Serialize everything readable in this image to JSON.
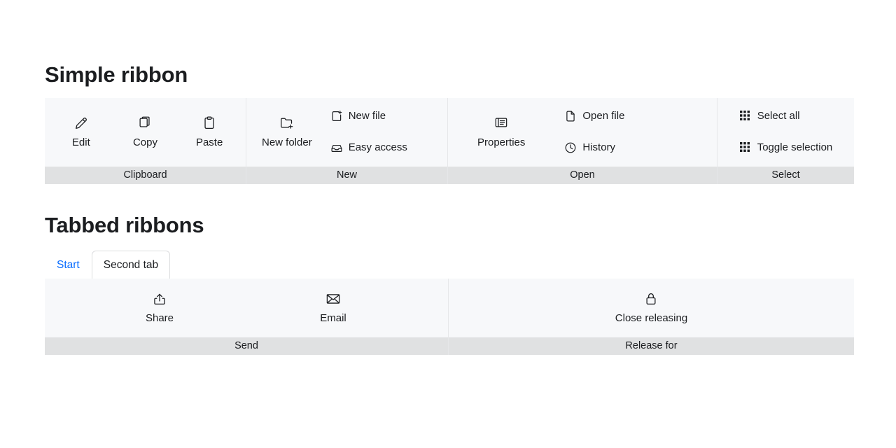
{
  "sections": {
    "simple": {
      "title": "Simple ribbon"
    },
    "tabbed": {
      "title": "Tabbed ribbons"
    }
  },
  "colors": {
    "ribbon_bg": "#f7f8fa",
    "footer_bg": "#e0e1e2",
    "separator": "#e6e7e9",
    "text": "#1b1d20",
    "active_tab_text": "#0a6dff",
    "tab_border": "#dcdddf"
  },
  "simple_ribbon": {
    "groups": [
      {
        "footer": "Clipboard",
        "large_items": [
          {
            "label": "Edit",
            "icon": "pencil-icon"
          },
          {
            "label": "Copy",
            "icon": "copy-icon"
          },
          {
            "label": "Paste",
            "icon": "clipboard-icon"
          }
        ],
        "small_items": []
      },
      {
        "footer": "New",
        "large_items": [
          {
            "label": "New folder",
            "icon": "folder-add-icon"
          }
        ],
        "small_items": [
          {
            "label": "New file",
            "icon": "file-add-icon"
          },
          {
            "label": "Easy access",
            "icon": "inbox-icon"
          }
        ]
      },
      {
        "footer": "Open",
        "large_items": [
          {
            "label": "Properties",
            "icon": "list-details-icon"
          }
        ],
        "small_items": [
          {
            "label": "Open file",
            "icon": "document-icon"
          },
          {
            "label": "History",
            "icon": "clock-icon"
          }
        ]
      },
      {
        "footer": "Select",
        "large_items": [],
        "small_items": [
          {
            "label": "Select all",
            "icon": "grid-dots-icon"
          },
          {
            "label": "Toggle selection",
            "icon": "grid-dots-icon"
          }
        ]
      }
    ]
  },
  "tabbed_ribbon": {
    "tabs": [
      {
        "label": "Start",
        "state": "active"
      },
      {
        "label": "Second tab",
        "state": "inactive"
      }
    ],
    "groups": [
      {
        "footer": "Send",
        "large_items": [
          {
            "label": "Share",
            "icon": "share-icon"
          },
          {
            "label": "Email",
            "icon": "envelope-icon"
          }
        ],
        "small_items": []
      },
      {
        "footer": "Release for",
        "large_items": [
          {
            "label": "Close releasing",
            "icon": "lock-icon"
          }
        ],
        "small_items": []
      }
    ]
  }
}
